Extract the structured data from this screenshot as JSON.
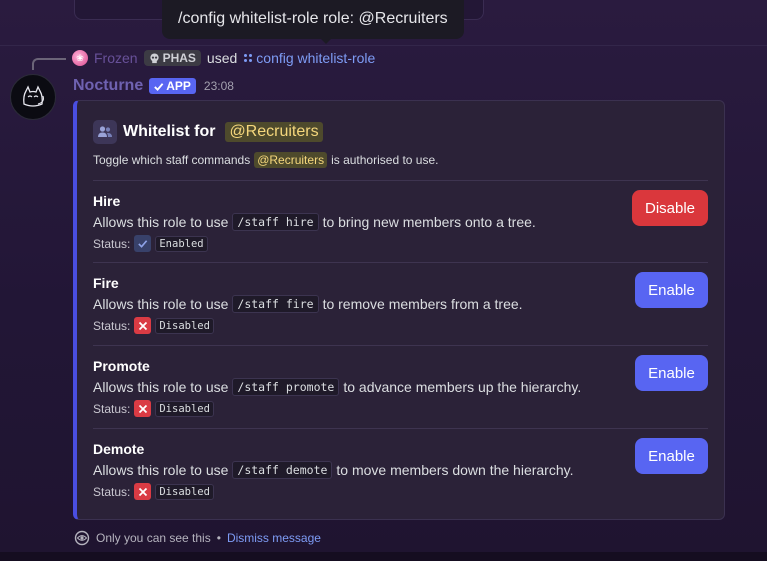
{
  "tooltip": {
    "text": "/config whitelist-role role: @Recruiters"
  },
  "reply": {
    "avatar_glyph": "❀",
    "username": "Frozen",
    "guild_tag": "PHAS",
    "guild_icon": "skull-icon",
    "used_text": "used",
    "command": "config whitelist-role",
    "command_icon": "slash-command-icon"
  },
  "message": {
    "author": "Nocturne",
    "app_badge": "APP",
    "timestamp": "23:08"
  },
  "embed": {
    "accent_color": "#4a4ee0",
    "title_prefix": "Whitelist for",
    "title_role": "@Recruiters",
    "desc_before": "Toggle which staff commands",
    "desc_role": "@Recruiters",
    "desc_after": "is authorised to use.",
    "status_label": "Status:",
    "use_prefix": "Allows this role to use",
    "permissions": [
      {
        "name": "Hire",
        "command": "/staff hire",
        "desc_after": "to bring new members onto a tree.",
        "status": "Enabled",
        "button": "Disable",
        "button_color": "#da373c"
      },
      {
        "name": "Fire",
        "command": "/staff fire",
        "desc_after": "to remove members from a tree.",
        "status": "Disabled",
        "button": "Enable",
        "button_color": "#5865f2"
      },
      {
        "name": "Promote",
        "command": "/staff promote",
        "desc_after": "to advance members up the hierarchy.",
        "status": "Disabled",
        "button": "Enable",
        "button_color": "#5865f2"
      },
      {
        "name": "Demote",
        "command": "/staff demote",
        "desc_after": "to move members down the hierarchy.",
        "status": "Disabled",
        "button": "Enable",
        "button_color": "#5865f2"
      }
    ]
  },
  "footer": {
    "visibility_text": "Only you can see this",
    "bullet": "•",
    "dismiss": "Dismiss message"
  }
}
